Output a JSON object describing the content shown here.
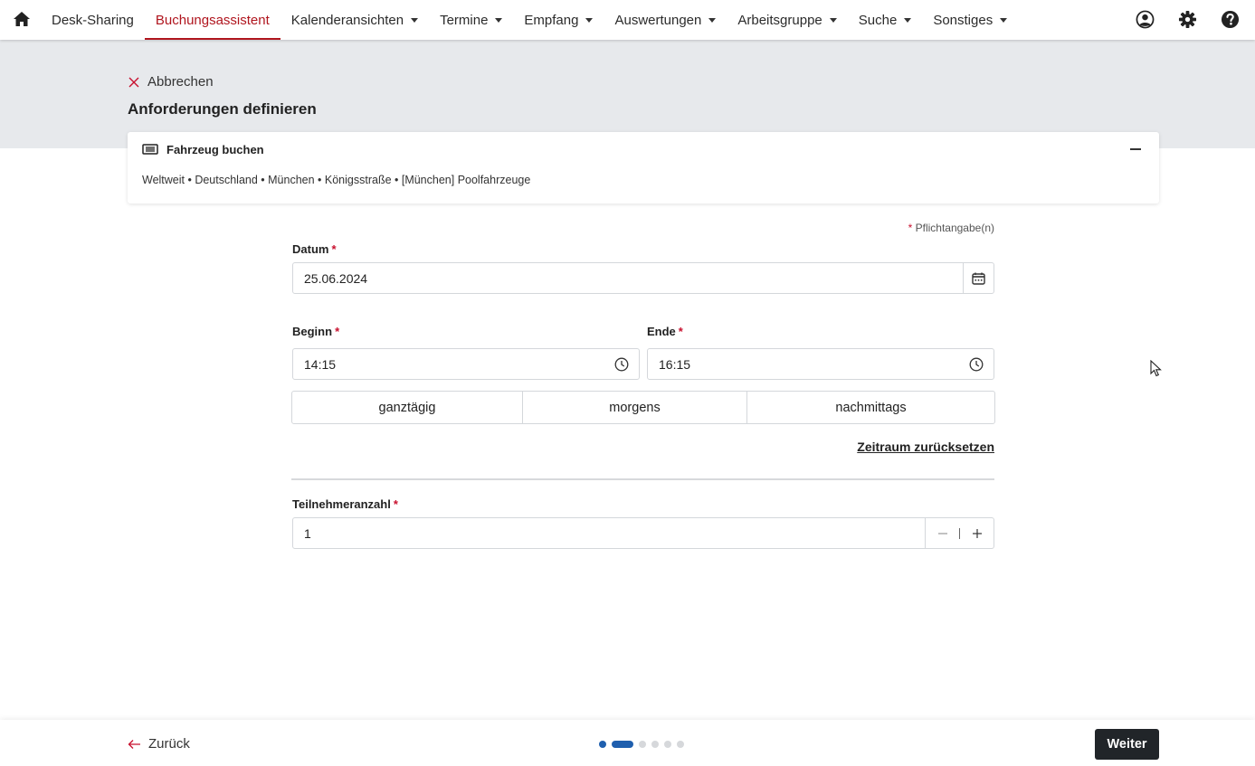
{
  "nav": {
    "items": [
      {
        "label": "Desk-Sharing",
        "dropdown": false,
        "active": false
      },
      {
        "label": "Buchungsassistent",
        "dropdown": false,
        "active": true
      },
      {
        "label": "Kalenderansichten",
        "dropdown": true,
        "active": false
      },
      {
        "label": "Termine",
        "dropdown": true,
        "active": false
      },
      {
        "label": "Empfang",
        "dropdown": true,
        "active": false
      },
      {
        "label": "Auswertungen",
        "dropdown": true,
        "active": false
      },
      {
        "label": "Arbeitsgruppe",
        "dropdown": true,
        "active": false
      },
      {
        "label": "Suche",
        "dropdown": true,
        "active": false
      },
      {
        "label": "Sonstiges",
        "dropdown": true,
        "active": false
      }
    ],
    "icons": [
      "home-icon",
      "user-circle-icon",
      "gear-icon",
      "help-icon"
    ]
  },
  "header": {
    "cancel_label": "Abbrechen",
    "title": "Anforderungen definieren"
  },
  "card": {
    "title": "Fahrzeug buchen",
    "path": "Weltweit • Deutschland • München • Königsstraße • [München] Poolfahrzeuge"
  },
  "form": {
    "required_note": "Pflichtangabe(n)",
    "date_label": "Datum",
    "date_value": "25.06.2024",
    "start_label": "Beginn",
    "start_value": "14:15",
    "end_label": "Ende",
    "end_value": "16:15",
    "presets": [
      "ganztägig",
      "morgens",
      "nachmittags"
    ],
    "reset_label": "Zeitraum zurücksetzen",
    "participants_label": "Teilnehmeranzahl",
    "participants_value": "1"
  },
  "footer": {
    "back_label": "Zurück",
    "next_label": "Weiter",
    "step_current": 2,
    "step_total": 6
  },
  "colors": {
    "accent": "#b0151e",
    "required": "#c8102e",
    "primary_dark": "#212529",
    "progress": "#1f5fae",
    "band": "#e7e9ec"
  }
}
